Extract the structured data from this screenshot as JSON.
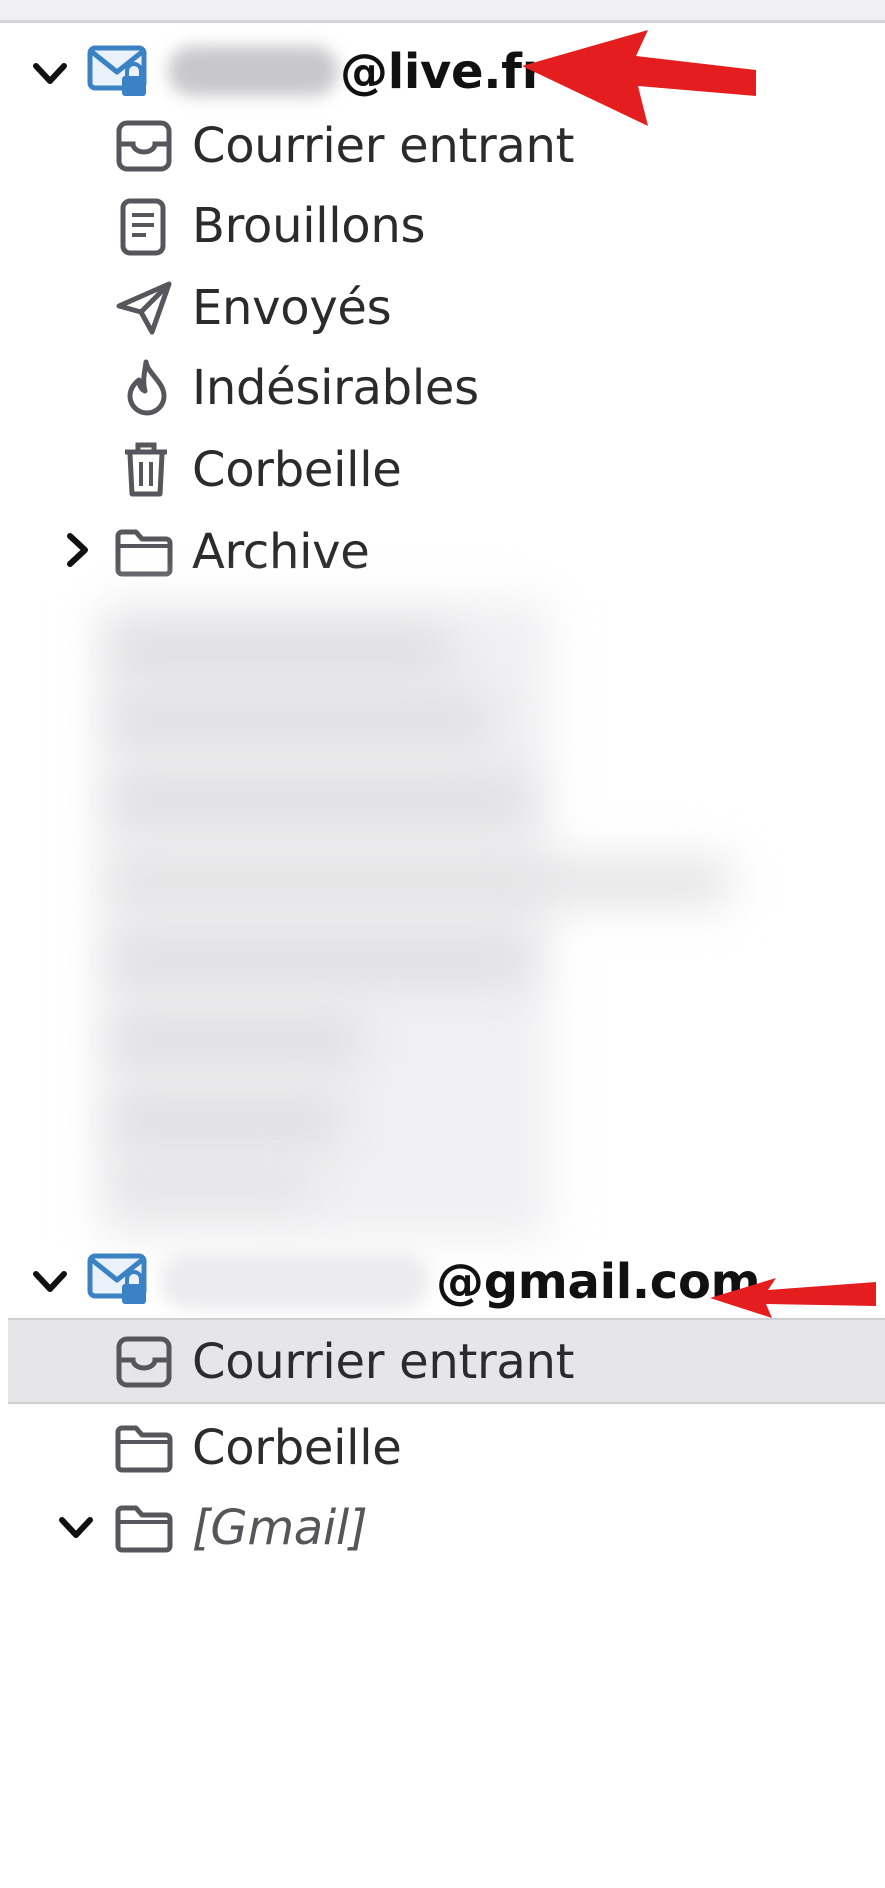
{
  "accounts": [
    {
      "domain": "@live.fr",
      "folders": [
        {
          "label": "Courrier entrant",
          "icon": "inbox-icon"
        },
        {
          "label": "Brouillons",
          "icon": "drafts-icon"
        },
        {
          "label": "Envoyés",
          "icon": "sent-icon"
        },
        {
          "label": "Indésirables",
          "icon": "junk-icon"
        },
        {
          "label": "Corbeille",
          "icon": "trash-icon"
        },
        {
          "label": "Archive",
          "icon": "folder-icon"
        }
      ]
    },
    {
      "domain": "@gmail.com",
      "folders": [
        {
          "label": "Courrier entrant",
          "icon": "inbox-icon",
          "selected": true
        },
        {
          "label": "Corbeille",
          "icon": "folder-icon"
        },
        {
          "label": "[Gmail]",
          "icon": "folder-icon"
        }
      ]
    }
  ],
  "colors": {
    "account_icon": "#3b82c4",
    "folder_icon": "#56565c",
    "annotation_arrow": "#e41e1e",
    "selected_row": "#e6e6e8"
  }
}
